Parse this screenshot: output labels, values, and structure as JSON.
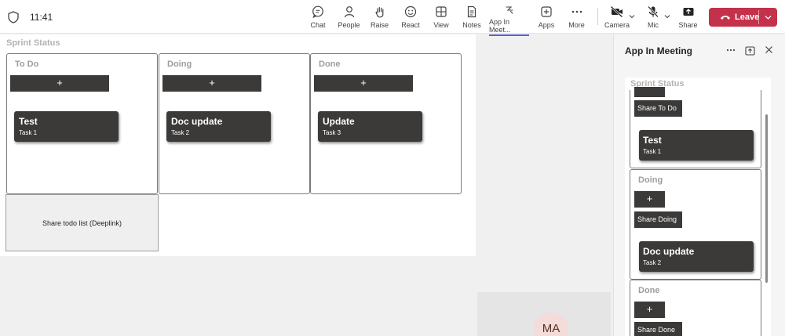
{
  "topbar": {
    "time": "11:41",
    "items": [
      {
        "label": "Chat",
        "icon": "chat-icon"
      },
      {
        "label": "People",
        "icon": "people-icon"
      },
      {
        "label": "Raise",
        "icon": "hand-icon"
      },
      {
        "label": "React",
        "icon": "emoji-icon"
      },
      {
        "label": "View",
        "icon": "grid-icon"
      },
      {
        "label": "Notes",
        "icon": "notes-icon"
      },
      {
        "label": "App In Meet...",
        "icon": "app-icon"
      },
      {
        "label": "Apps",
        "icon": "plus-square-icon"
      },
      {
        "label": "More",
        "icon": "more-icon"
      }
    ],
    "camera_label": "Camera",
    "mic_label": "Mic",
    "share_label": "Share",
    "leave_label": "Leave",
    "accent": "#5b5fc7",
    "leave_color": "#c4314b"
  },
  "board": {
    "title": "Sprint Status",
    "add_label": "+",
    "columns": [
      {
        "title": "To Do",
        "card": {
          "title": "Test",
          "subtitle": "Task 1"
        }
      },
      {
        "title": "Doing",
        "card": {
          "title": "Doc update",
          "subtitle": "Task 2"
        }
      },
      {
        "title": "Done",
        "card": {
          "title": "Update",
          "subtitle": "Task 3"
        }
      }
    ],
    "share_deeplink_label": "Share todo list (Deeplink)"
  },
  "participant": {
    "initials": "MA"
  },
  "panel": {
    "title": "App In Meeting",
    "board_title": "Sprint Status",
    "add_label": "+",
    "todo": {
      "share_label": "Share To Do",
      "card": {
        "title": "Test",
        "subtitle": "Task 1"
      }
    },
    "doing": {
      "title": "Doing",
      "share_label": "Share Doing",
      "card": {
        "title": "Doc update",
        "subtitle": "Task 2"
      }
    },
    "done": {
      "title": "Done",
      "share_label": "Share Done"
    }
  }
}
